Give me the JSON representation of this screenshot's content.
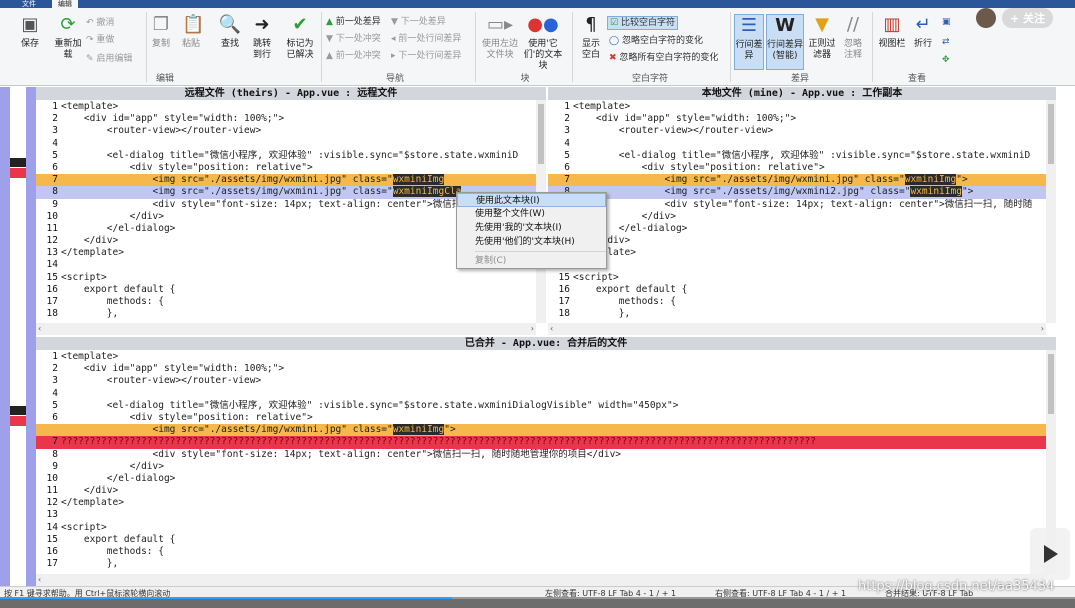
{
  "tabs": [
    "文件",
    "编辑"
  ],
  "follow_label": "+ 关注",
  "ribbon": {
    "buttons": {
      "save": "保存",
      "reload": "重新加载",
      "copy": "复制",
      "paste": "粘贴",
      "find": "查找",
      "goto": "跳转到行",
      "mark": "标记为已解决",
      "use_left": "使用左边文件块",
      "use_theirs": "使用'它们'的文本块",
      "show_ws": "显示空白",
      "line_diff": "行间差异",
      "line_diff_smart": "行间差异(智能)",
      "regex_filter": "正则过滤器",
      "ignore_comments": "忽略注释",
      "view_column": "视图栏",
      "wrap": "折行"
    },
    "undo_items": [
      "撤消",
      "重做",
      "启用编辑"
    ],
    "nav_items": [
      "前一处差异",
      "下一处差异",
      "下一处冲突",
      "前一处冲突",
      "前一处行间差异",
      "下一处行间差异"
    ],
    "ws_items": [
      "比较空白字符",
      "忽略空白字符的变化",
      "忽略所有空白字符的变化"
    ],
    "groups": [
      "编辑",
      "导航",
      "块",
      "空白字符",
      "差异",
      "查看"
    ]
  },
  "panes": {
    "theirs_title": "远程文件 (theirs) - App.vue : 远程文件",
    "mine_title": "本地文件 (mine) - App.vue : 工作副本",
    "merged_title": "已合并 - App.vue: 合并后的文件"
  },
  "theirs_lines": [
    "<template>",
    "    <div id=\"app\" style=\"width: 100%;\">",
    "        <router-view></router-view>",
    "",
    "        <el-dialog title=\"微信小程序, 欢迎体验\" :visible.sync=\"$store.state.wxminiD",
    "            <div style=\"position: relative\">",
    "                <img src=\"./assets/img/wxmini.jpg\" class=\"",
    "                <img src=\"./assets/img/wxmini.jpg\" class=\"",
    "                <div style=\"font-size: 14px; text-align: center\">微信扫",
    "            </div>",
    "        </el-dialog>",
    "    </div>",
    "</template>",
    "",
    "<script>",
    "    export default {",
    "        methods: {",
    "        },"
  ],
  "theirs_sel": [
    "wxminiImg",
    "wxminiImgCla"
  ],
  "mine_lines": [
    "<template>",
    "    <div id=\"app\" style=\"width: 100%;\">",
    "        <router-view></router-view>",
    "",
    "        <el-dialog title=\"微信小程序, 欢迎体验\" :visible.sync=\"$store.state.wxminiD",
    "            <div style=\"position: relative\">",
    "                <img src=\"./assets/img/wxmini.jpg\" class=\"",
    "                <img src=\"./assets/img/wxmini2.jpg\" class=\"",
    "                <div style=\"font-size: 14px; text-align: center\">微信扫一扫, 随时随",
    "            </div>",
    "        </el-dialog>",
    "    </div>",
    "</template>",
    "",
    "<script>",
    "    export default {",
    "        methods: {",
    "        },"
  ],
  "mine_sel": [
    "wxminiImg",
    "wxminiImg"
  ],
  "mine_tail": [
    "\">",
    "\">"
  ],
  "merged_lines": [
    "<template>",
    "    <div id=\"app\" style=\"width: 100%;\">",
    "        <router-view></router-view>",
    "",
    "        <el-dialog title=\"微信小程序, 欢迎体验\" :visible.sync=\"$store.state.wxminiDialogVisible\" width=\"450px\">",
    "            <div style=\"position: relative\">",
    "                <img src=\"./assets/img/wxmini.jpg\" class=\"",
    "????????????????????????????????????????????????????????????????????????????????????????????????????????????????????????????????????",
    "                <div style=\"font-size: 14px; text-align: center\">微信扫一扫, 随时随地管理你的项目</div>",
    "            </div>",
    "        </el-dialog>",
    "    </div>",
    "</template>",
    "",
    "<script>",
    "    export default {",
    "        methods: {",
    "        },"
  ],
  "merged_sel": "wxminiImg",
  "merged_tail": "\">",
  "merged_numbers": [
    "1",
    "2",
    "3",
    "4",
    "5",
    "6",
    "",
    "7",
    "8",
    "9",
    "10",
    "11",
    "12",
    "13",
    "14",
    "15",
    "16",
    "17"
  ],
  "context_menu": [
    "使用此文本块(I)",
    "使用整个文件(W)",
    "先使用'我的'文本块(I)",
    "先使用'他们的'文本块(H)",
    "复制(C)"
  ],
  "status": {
    "hint": "按 F1 键寻求帮助。用 Ctrl+鼠标滚轮横向滚动",
    "left": "左侧查看:  UTF-8    LF    Tab 4    - 1 / + 1",
    "right": "右侧查看:  UTF-8    LF    Tab 4    - 1 / + 1",
    "merged": "合并结果:  UTF-8    LF    Tab"
  },
  "watermark": "https://blog.csdn.net/aa35434",
  "video_progress": 0.42
}
